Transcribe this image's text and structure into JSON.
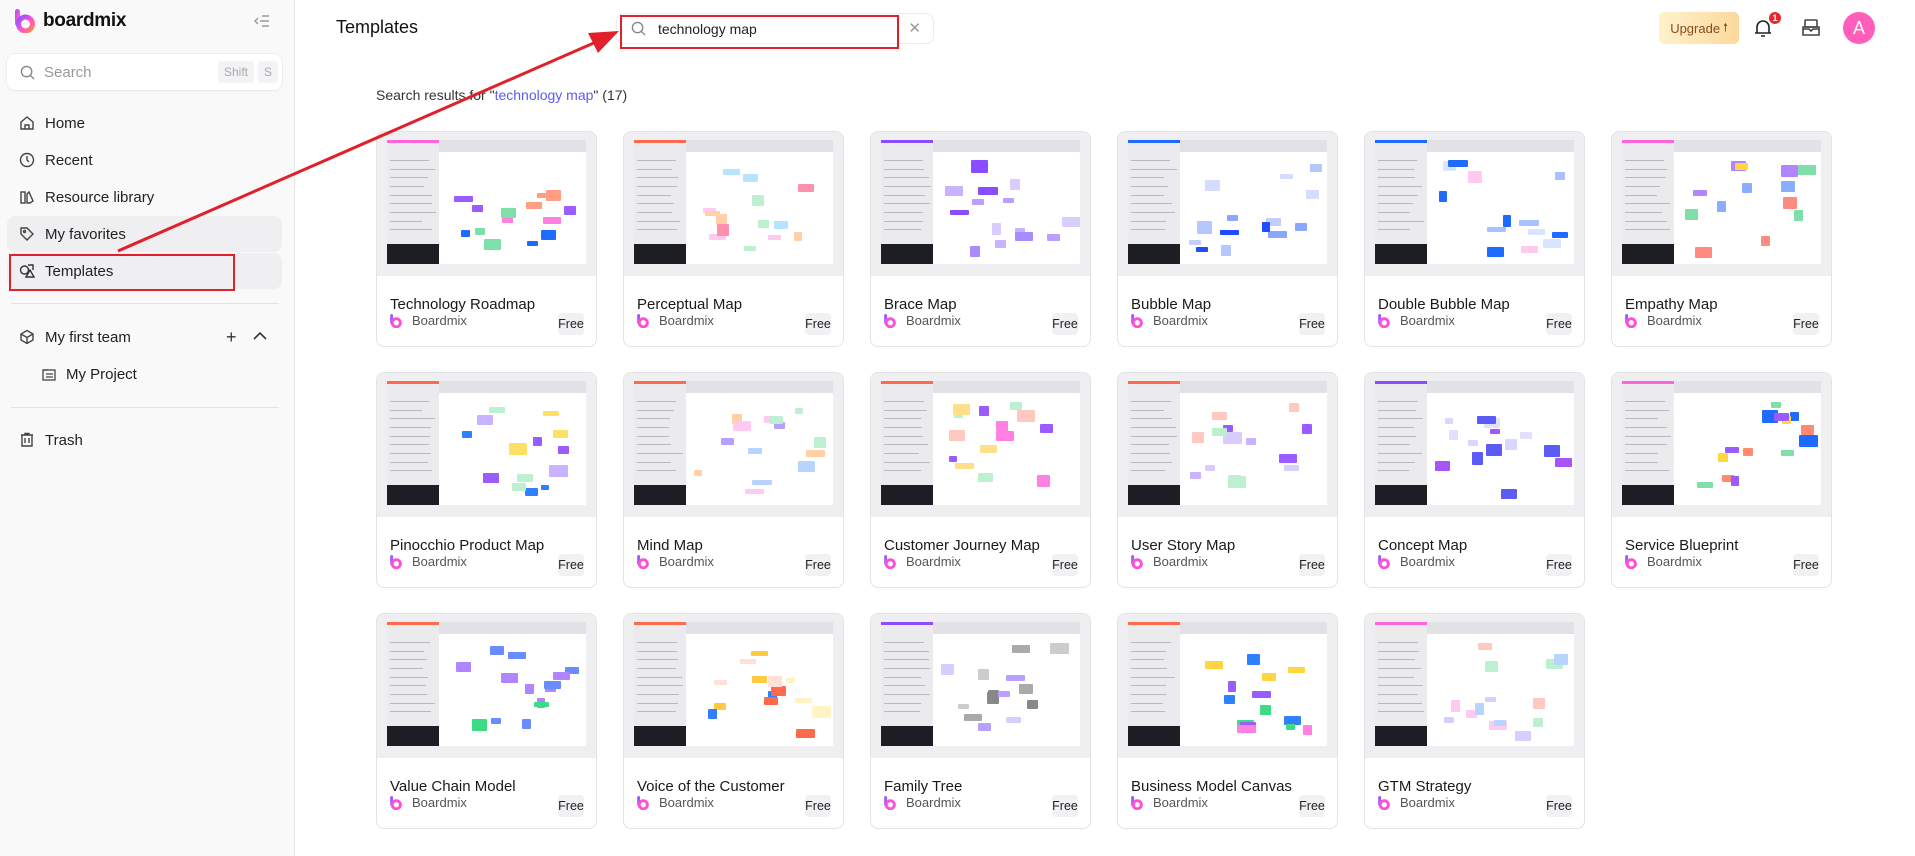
{
  "sidebar": {
    "brand": "boardmix",
    "search_placeholder": "Search",
    "shortcut": [
      "Shift",
      "S"
    ],
    "nav": [
      {
        "label": "Home",
        "icon": "home-icon"
      },
      {
        "label": "Recent",
        "icon": "clock-icon"
      },
      {
        "label": "Resource library",
        "icon": "library-icon"
      },
      {
        "label": "My favorites",
        "icon": "tag-icon"
      },
      {
        "label": "Templates",
        "icon": "templates-icon",
        "selected": true
      }
    ],
    "team": {
      "label": "My first team",
      "projects": [
        "My Project"
      ]
    },
    "trash": "Trash"
  },
  "header": {
    "title": "Templates",
    "search_value": "technology map",
    "upgrade_label": "Upgrade",
    "notification_count": "1",
    "avatar_initial": "A",
    "avatar_color": "#ff5fba"
  },
  "results": {
    "prefix": "Search results for \"",
    "query": "technology map",
    "suffix": "\" (17)"
  },
  "annotation_color": "#e0202a",
  "cards": [
    {
      "title": "Technology Roadmap",
      "author": "Boardmix",
      "price": "Free",
      "accent": "#ff66dd",
      "colors": [
        "#1f6bff",
        "#7ee0a8",
        "#ff9e80",
        "#9b5cff",
        "#ff80e0"
      ]
    },
    {
      "title": "Perceptual Map",
      "author": "Boardmix",
      "price": "Free",
      "accent": "#ff6a4d",
      "colors": [
        "#ffc9f0",
        "#b7e3ff",
        "#bdf0d0",
        "#ffcfa8",
        "#ff8fb0"
      ]
    },
    {
      "title": "Brace Map",
      "author": "Boardmix",
      "price": "Free",
      "accent": "#8a4dff",
      "colors": [
        "#c9b2ff",
        "#b9a0ff",
        "#8a4dff",
        "#d9ccff",
        "#a88bff"
      ]
    },
    {
      "title": "Bubble Map",
      "author": "Boardmix",
      "price": "Free",
      "accent": "#1f6bff",
      "colors": [
        "#b4c8ff",
        "#1f4cff",
        "#d4dcff",
        "#8aa6ff",
        "#c1d0ff"
      ]
    },
    {
      "title": "Double Bubble Map",
      "author": "Boardmix",
      "price": "Free",
      "accent": "#1f6bff",
      "colors": [
        "#1f6bff",
        "#ffc9f0",
        "#a9c1ff",
        "#d9e4ff",
        "#1f6bff"
      ]
    },
    {
      "title": "Empathy Map",
      "author": "Boardmix",
      "price": "Free",
      "accent": "#ff66dd",
      "colors": [
        "#7ee0a8",
        "#8aaeff",
        "#b085ff",
        "#ff8a80",
        "#ffd640"
      ]
    },
    {
      "title": "Pinocchio Product Map",
      "author": "Boardmix",
      "price": "Free",
      "accent": "#ff6a4d",
      "colors": [
        "#ffe066",
        "#9b5cff",
        "#2f80ff",
        "#bdf0d0",
        "#c9b2ff"
      ]
    },
    {
      "title": "Mind Map",
      "author": "Boardmix",
      "price": "Free",
      "accent": "#ff6a4d",
      "colors": [
        "#bdf0d0",
        "#ffcfa8",
        "#b7d4ff",
        "#ffc9f0",
        "#b5a0ff"
      ]
    },
    {
      "title": "Customer Journey Map",
      "author": "Boardmix",
      "price": "Free",
      "accent": "#ff6a4d",
      "colors": [
        "#ff80e0",
        "#ffe08a",
        "#bdf0d0",
        "#9b5cff",
        "#ffc9c0"
      ]
    },
    {
      "title": "User Story Map",
      "author": "Boardmix",
      "price": "Free",
      "accent": "#ff6a4d",
      "colors": [
        "#9b5cff",
        "#bdf0d0",
        "#d9ccff",
        "#ffc9c0",
        "#c9b2ff"
      ]
    },
    {
      "title": "Concept Map",
      "author": "Boardmix",
      "price": "Free",
      "accent": "#8a4dff",
      "colors": [
        "#e3e0ff",
        "#5b5bf5",
        "#a855f7",
        "#d9d6ff",
        "#5b5bf5"
      ]
    },
    {
      "title": "Service Blueprint",
      "author": "Boardmix",
      "price": "Free",
      "accent": "#ff66dd",
      "colors": [
        "#1f6bff",
        "#9b5cff",
        "#7ee0a8",
        "#ff8a70",
        "#ffd640"
      ]
    },
    {
      "title": "Value Chain Model",
      "author": "Boardmix",
      "price": "Free",
      "accent": "#ff6a4d",
      "colors": [
        "#6b8cff",
        "#6b8cff",
        "#b085ff",
        "#b085ff",
        "#3ddc84"
      ]
    },
    {
      "title": "Voice of the Customer",
      "author": "Boardmix",
      "price": "Free",
      "accent": "#ff6a4d",
      "colors": [
        "#ff6a4d",
        "#ffe0d6",
        "#ffc940",
        "#fff3c4",
        "#2f80ff"
      ]
    },
    {
      "title": "Family Tree",
      "author": "Boardmix",
      "price": "Free",
      "accent": "#8a4dff",
      "colors": [
        "#b9a0ff",
        "#888888",
        "#cccccc",
        "#aaaaaa",
        "#d9ccff"
      ]
    },
    {
      "title": "Business Model Canvas",
      "author": "Boardmix",
      "price": "Free",
      "accent": "#ff6a4d",
      "colors": [
        "#2f80ff",
        "#3ddc84",
        "#ffd640",
        "#9b5cff",
        "#ff80e0"
      ]
    },
    {
      "title": "GTM Strategy",
      "author": "Boardmix",
      "price": "Free",
      "accent": "#ff66dd",
      "colors": [
        "#ffc9f0",
        "#bdf0d0",
        "#b7d4ff",
        "#d9ccff",
        "#ffc9c0"
      ]
    }
  ]
}
